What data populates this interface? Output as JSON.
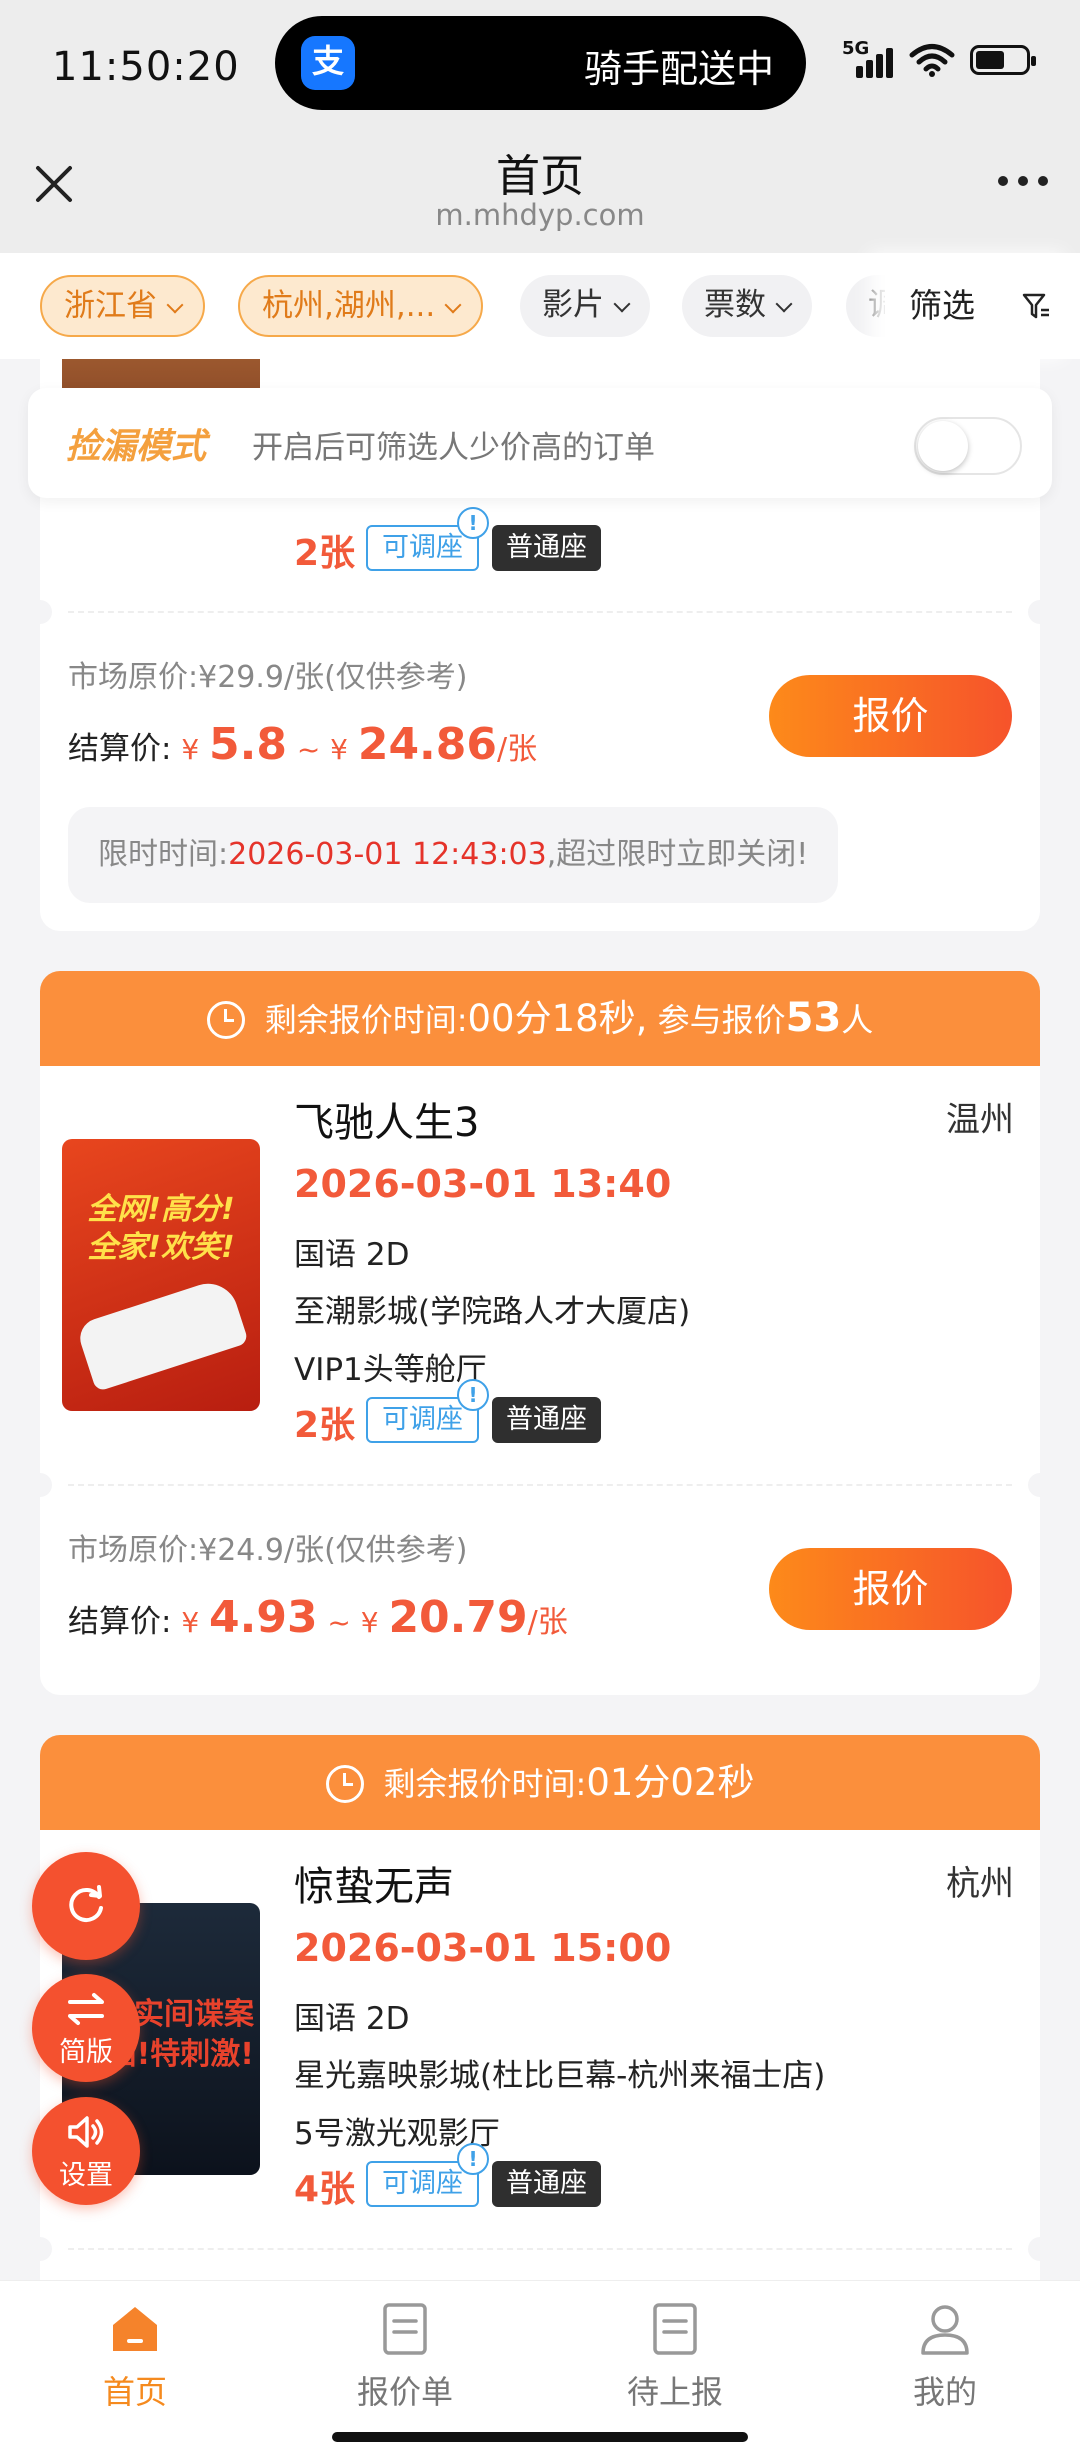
{
  "status_bar": {
    "time": "11:50:20",
    "island_app_glyph": "支",
    "island_text": "骑手配送中",
    "network": "5G"
  },
  "nav": {
    "title": "首页",
    "url": "m.mhdyp.com"
  },
  "filters": {
    "province": "浙江省",
    "cities": "杭州,湖州,...",
    "movie": "影片",
    "count": "票数",
    "partial": "调",
    "filter": "筛选"
  },
  "leak_mode": {
    "title": "捡漏模式",
    "description": "开启后可筛选人少价高的订单",
    "enabled": false
  },
  "labels": {
    "adjustable": "可调座",
    "seat_type": "普通座",
    "market_prefix": "市场原价:",
    "settle_prefix": "结算价:",
    "yen": "¥",
    "tilde": "~",
    "per_ticket": "/张",
    "quote": "报价",
    "deadline_prefix": "限时时间:",
    "deadline_suffix": ",超过限时立即关闭!",
    "countdown_prefix": "剩余报价时间:",
    "participants_prefix": "参与报价",
    "participants_unit": "人",
    "bang": "!"
  },
  "cards": [
    {
      "tickets": "2张",
      "market_price": "¥29.9/张(仅供参考)",
      "settle_min": "5.8",
      "settle_max": "24.86",
      "deadline": "2026-03-01 12:43:03"
    },
    {
      "countdown": "00分18秒,",
      "participants": "53",
      "title": "飞驰人生3",
      "city": "温州",
      "showtime": "2026-03-01 13:40",
      "lang": "国语 2D",
      "cinema": "至潮影城(学院路人才大厦店)",
      "hall": "VIP1头等舱厅",
      "tickets": "2张",
      "market_price": "¥24.9/张(仅供参考)",
      "settle_min": "4.93",
      "settle_max": "20.79",
      "poster_text1": "全网!高分!",
      "poster_text2": "全家!欢笑!"
    },
    {
      "countdown": "01分02秒",
      "title": "惊蛰无声",
      "city": "杭州",
      "showtime": "2026-03-01 15:00",
      "lang": "国语 2D",
      "cinema": "星光嘉映影城(杜比巨幕-杭州来福士店)",
      "hall": "5号激光观影厅",
      "tickets": "4张",
      "poster_text1": "真实间谍案",
      "poster_text2": "拍!特刺激!"
    }
  ],
  "fabs": {
    "switch": "简版",
    "settings": "设置"
  },
  "tabs": [
    {
      "label": "首页",
      "icon": "home-icon",
      "active": true
    },
    {
      "label": "报价单",
      "icon": "document-icon",
      "active": false
    },
    {
      "label": "待上报",
      "icon": "document-icon",
      "active": false
    },
    {
      "label": "我的",
      "icon": "user-icon",
      "active": false
    }
  ],
  "colors": {
    "accent": "#f58a1e",
    "price_red": "#f25a3a",
    "header_orange": "#fb8f3c",
    "tag_blue": "#3fa1e8"
  }
}
